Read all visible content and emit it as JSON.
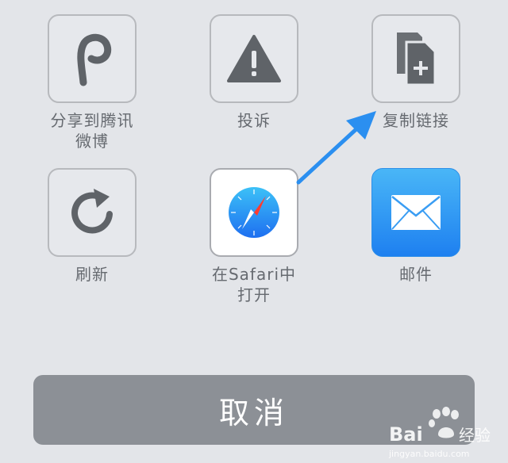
{
  "share_items": [
    {
      "label": "分享到腾讯\n微博",
      "icon": "tencent-weibo-icon"
    },
    {
      "label": "投诉",
      "icon": "warning-icon"
    },
    {
      "label": "复制链接",
      "icon": "copy-link-icon"
    },
    {
      "label": "刷新",
      "icon": "refresh-icon"
    },
    {
      "label": "在Safari中\n打开",
      "icon": "safari-compass-icon"
    },
    {
      "label": "邮件",
      "icon": "mail-envelope-icon"
    }
  ],
  "cancel_label": "取消",
  "watermark": {
    "brand": "Bai度经验",
    "url": "jingyan.baidu.com"
  },
  "colors": {
    "accent_arrow": "#2b8ff0",
    "mail_tile": "#2d8fe8",
    "cancel_bg": "#8c9096"
  }
}
